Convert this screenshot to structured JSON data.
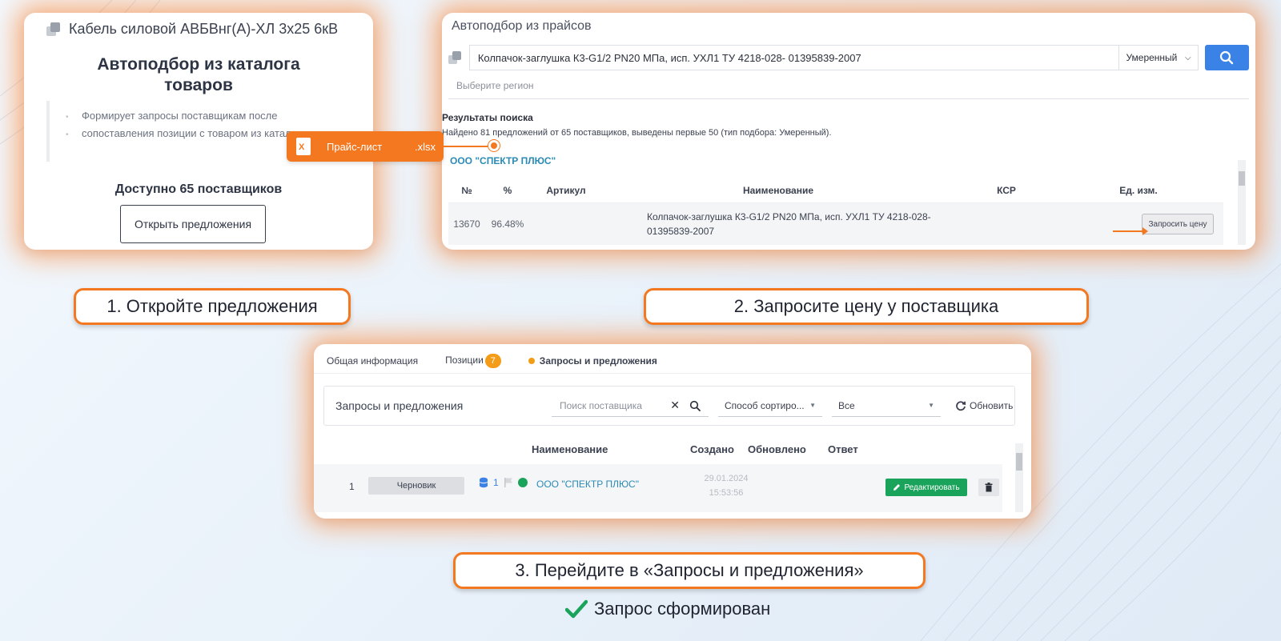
{
  "card1": {
    "product_title": "Кабель силовой АВБВнг(А)-ХЛ 3х25 6кВ",
    "heading": "Автоподбор из каталога товаров",
    "description_line1": "Формирует запросы поставщикам после",
    "description_line2": "сопоставления позиции с товаром из каталога",
    "available": "Доступно 65 поставщиков",
    "open_button": "Открыть предложения"
  },
  "xls_badge": {
    "name": "Прайс-лист",
    "ext": ".xlsx",
    "icon_letter": "X"
  },
  "card2": {
    "title": "Автоподбор из прайсов",
    "search_value": "Колпачок-заглушка К3-G1/2 PN20 МПа, исп. УХЛ1 ТУ 4218-028- 01395839-2007",
    "mode": "Умеренный",
    "region_placeholder": "Выберите регион",
    "results_title": "Результаты поиска",
    "results_info": "Найдено 81 предложений от 65 поставщиков, выведены первые 50 (тип подбора: Умеренный).",
    "supplier": "ООО \"СПЕКТР ПЛЮС\"",
    "columns": {
      "no": "№",
      "pct": "%",
      "article": "Артикул",
      "name": "Наименование",
      "ksr": "КСР",
      "unit": "Ед. изм."
    },
    "row": {
      "no": "13670",
      "pct": "96.48%",
      "name_line1": "Колпачок-заглушка К3-G1/2 PN20 МПа, исп. УХЛ1 ТУ 4218-028-",
      "name_line2": "01395839-2007",
      "request_button": "Запросить цену"
    }
  },
  "card3": {
    "tabs": {
      "general": "Общая информация",
      "positions": "Позиции",
      "positions_count": "7",
      "requests": "Запросы и предложения"
    },
    "toolbar": {
      "title": "Запросы и предложения",
      "search_placeholder": "Поиск поставщика",
      "sort_placeholder": "Способ сортиро...",
      "filter_value": "Все",
      "refresh": "Обновить"
    },
    "columns": {
      "name": "Наименование",
      "created": "Создано",
      "updated": "Обновлено",
      "answer": "Ответ"
    },
    "row": {
      "num": "1",
      "status": "Черновик",
      "count": "1",
      "supplier": "ООО \"СПЕКТР ПЛЮС\"",
      "created_date": "29.01.2024",
      "created_time": "15:53:56",
      "edit_button": "Редактировать"
    }
  },
  "steps": {
    "step1": "1. Откройте предложения",
    "step2": "2. Запросите цену у поставщика",
    "step3": "3. Перейдите в «Запросы и предложения»",
    "done": "Запрос сформирован"
  },
  "colors": {
    "accent_orange": "#f47820",
    "link_blue": "#2a8bb5",
    "button_blue": "#3b82e6",
    "success_green": "#1aa35a",
    "badge_orange": "#f39c18"
  }
}
